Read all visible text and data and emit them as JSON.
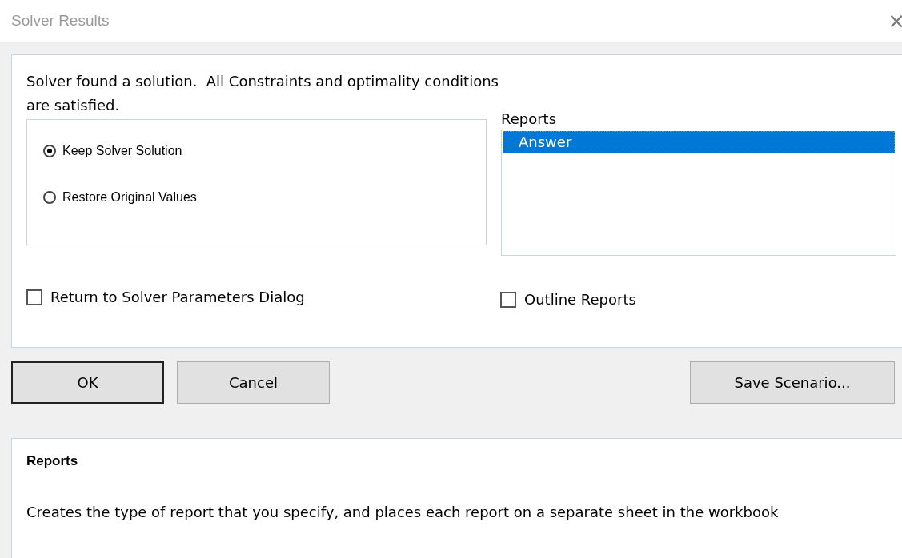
{
  "window": {
    "title": "Solver Results",
    "close": "×"
  },
  "message": "Solver found a solution.  All Constraints and optimality conditions are satisfied.",
  "options": [
    {
      "label": "Keep Solver Solution",
      "selected": true
    },
    {
      "label": "Restore Original Values",
      "selected": false
    }
  ],
  "reports": {
    "label": "Reports",
    "items": [
      {
        "label": "Answer",
        "selected": true
      }
    ]
  },
  "return_checkbox": {
    "label": "Return to Solver Parameters Dialog",
    "checked": false
  },
  "outline_checkbox": {
    "label": "Outline Reports",
    "checked": false
  },
  "buttons": [
    {
      "label": "OK",
      "default": true
    },
    {
      "label": "Cancel",
      "default": false
    }
  ],
  "save_button": {
    "label": "Save Scenario..."
  },
  "help": {
    "title": "Reports",
    "text": "Creates the type of report that you specify, and places each report on a separate sheet in the workbook"
  }
}
